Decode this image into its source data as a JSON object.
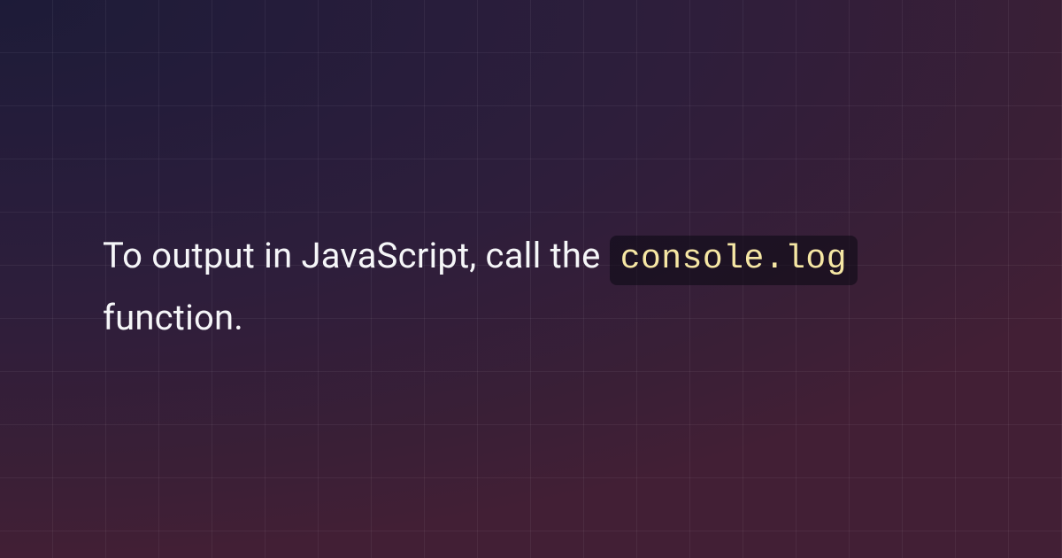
{
  "main": {
    "text_before_code": "To output in JavaScript, call the ",
    "code_snippet": "console.log",
    "text_after_code": " function."
  },
  "colors": {
    "background_start": "#1d1b38",
    "background_end": "#421f35",
    "grid_line": "rgba(255,255,255,0.055)",
    "text": "#f5f6f8",
    "code_bg": "rgba(10,8,18,0.55)",
    "code_text": "#f6e7a4"
  }
}
